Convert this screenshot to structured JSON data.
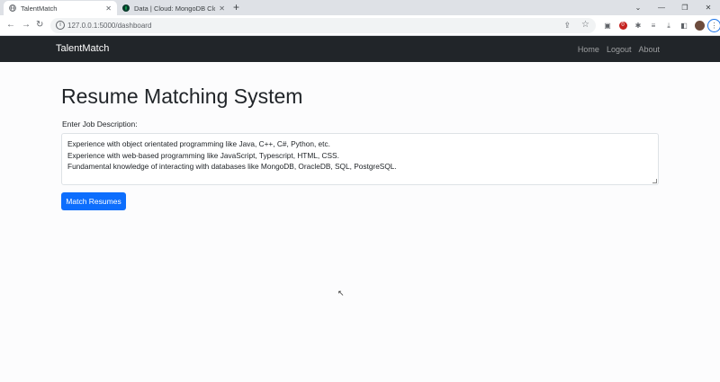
{
  "browser": {
    "tabs": [
      {
        "title": "TalentMatch",
        "icon": "globe-icon"
      },
      {
        "title": "Data | Cloud: MongoDB Cloud",
        "icon": "mongodb-leaf-icon"
      }
    ],
    "url": "127.0.0.1:5000/dashboard"
  },
  "navbar": {
    "brand": "TalentMatch",
    "links": [
      "Home",
      "Logout",
      "About"
    ]
  },
  "page": {
    "heading": "Resume Matching System",
    "job_description_label": "Enter Job Description:",
    "job_description_lines": [
      "Experience with object orientated programming like Java, C++, C#, Python, etc.",
      "Experience with web-based programming like JavaScript, Typescript, HTML, CSS.",
      "Fundamental knowledge of interacting with databases like MongoDB, OracleDB, SQL, PostgreSQL."
    ],
    "match_button": "Match Resumes"
  },
  "colors": {
    "navbar_bg": "#212529",
    "primary": "#0d6efd"
  }
}
